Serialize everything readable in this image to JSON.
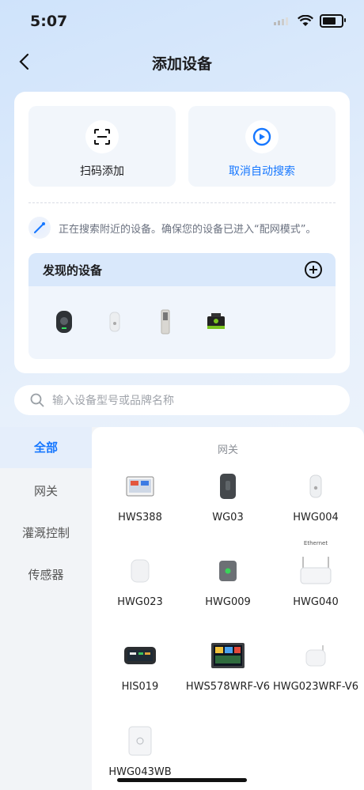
{
  "status": {
    "time": "5:07"
  },
  "nav": {
    "title": "添加设备"
  },
  "actions": {
    "scan_label": "扫码添加",
    "auto_search_label": "取消自动搜索"
  },
  "search_status": "正在搜索附近的设备。确保您的设备已进入“配网模式”。",
  "found": {
    "title": "发现的设备"
  },
  "search": {
    "placeholder": "输入设备型号或品牌名称"
  },
  "categories": [
    "全部",
    "网关",
    "灌溉控制",
    "传感器"
  ],
  "section_title": "网关",
  "products": [
    {
      "name": "HWS388"
    },
    {
      "name": "WG03"
    },
    {
      "name": "HWG004"
    },
    {
      "name": "HWG023"
    },
    {
      "name": "HWG009"
    },
    {
      "name": "HWG040"
    },
    {
      "name": "HIS019"
    },
    {
      "name": "HWS578WRF-V6"
    },
    {
      "name": "HWG023WRF-V6"
    },
    {
      "name": "HWG043WB"
    }
  ],
  "ethernet_label": "Ethernet",
  "colors": {
    "accent": "#1677ff",
    "highlight": "#e5eefb"
  }
}
